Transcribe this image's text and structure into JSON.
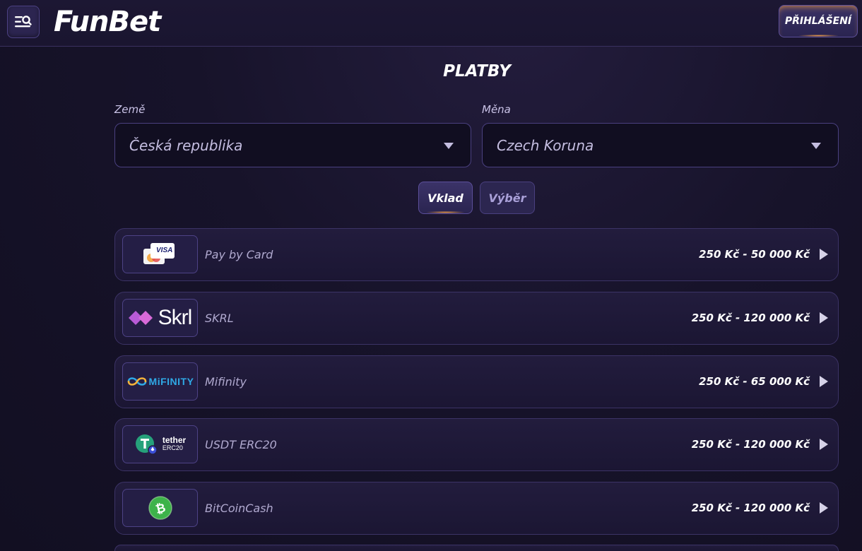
{
  "header": {
    "logo_text": "FunBet",
    "login_label": "PŘIHLÁŠENÍ",
    "menu_icon": "menu-search-icon"
  },
  "page": {
    "title": "PLATBY"
  },
  "filters": {
    "country_label": "Země",
    "country_value": "Česká republika",
    "currency_label": "Měna",
    "currency_value": "Czech Koruna"
  },
  "tabs": {
    "deposit": "Vklad",
    "withdraw": "Výběr",
    "active": "deposit"
  },
  "methods": [
    {
      "name": "Pay by Card",
      "range": "250 Kč - 50 000 Kč",
      "logo": "card-visa-icon",
      "logo_text": "VISA"
    },
    {
      "name": "SKRL",
      "range": "250 Kč - 120 000 Kč",
      "logo": "skrill-logo",
      "logo_text": "Skrl"
    },
    {
      "name": "Mifinity",
      "range": "250 Kč - 65 000 Kč",
      "logo": "mifinity-logo",
      "logo_text": "MiFINITY"
    },
    {
      "name": "USDT ERC20",
      "range": "250 Kč - 120 000 Kč",
      "logo": "tether-logo",
      "logo_text": "tether",
      "logo_subtext": "ERC20"
    },
    {
      "name": "BitCoinCash",
      "range": "250 Kč - 120 000 Kč",
      "logo": "bitcoin-cash-icon"
    }
  ],
  "colors": {
    "background": "#17132a",
    "accent_glow": "#f6a24a",
    "skrill_purple": "#b85bd6",
    "mifinity_blue": "#2fa9e6",
    "tether_green": "#26a17b",
    "bch_green": "#3db34a"
  }
}
